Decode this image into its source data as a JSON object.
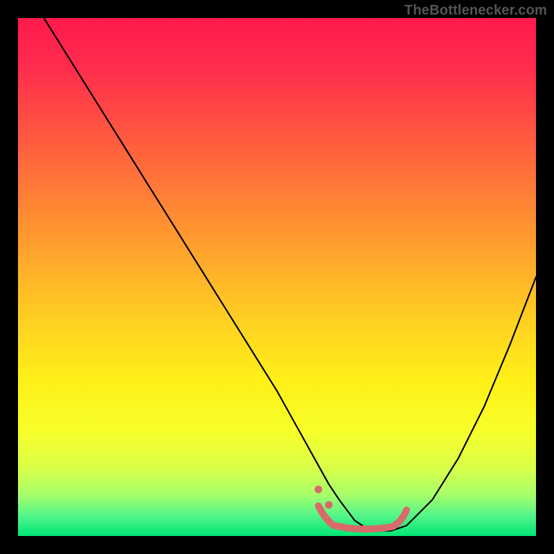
{
  "watermark": "TheBottlenecker.com",
  "colors": {
    "background": "#000000",
    "curve": "#000000",
    "trough_stroke": "#d86a6a",
    "gradient_top": "#ff1a4d",
    "gradient_bottom": "#00e676"
  },
  "chart_data": {
    "type": "line",
    "title": "",
    "xlabel": "",
    "ylabel": "",
    "xlim": [
      0,
      100
    ],
    "ylim": [
      0,
      100
    ],
    "series": [
      {
        "name": "curve",
        "x": [
          5,
          10,
          15,
          20,
          25,
          30,
          35,
          40,
          45,
          50,
          55,
          60,
          62,
          65,
          68,
          72,
          75,
          80,
          85,
          90,
          95,
          100
        ],
        "y": [
          100,
          92,
          84,
          76,
          68,
          60,
          52,
          44,
          36,
          28,
          19,
          10,
          7,
          3,
          1,
          1,
          2,
          7,
          15,
          25,
          37,
          50
        ]
      }
    ],
    "trough_highlight": {
      "x_range": [
        58,
        75
      ],
      "y": 1,
      "dots": [
        {
          "x": 58,
          "y": 9
        },
        {
          "x": 60,
          "y": 6
        }
      ]
    },
    "axes_visible": false,
    "grid": false,
    "background_gradient": "red-yellow-green vertical"
  }
}
